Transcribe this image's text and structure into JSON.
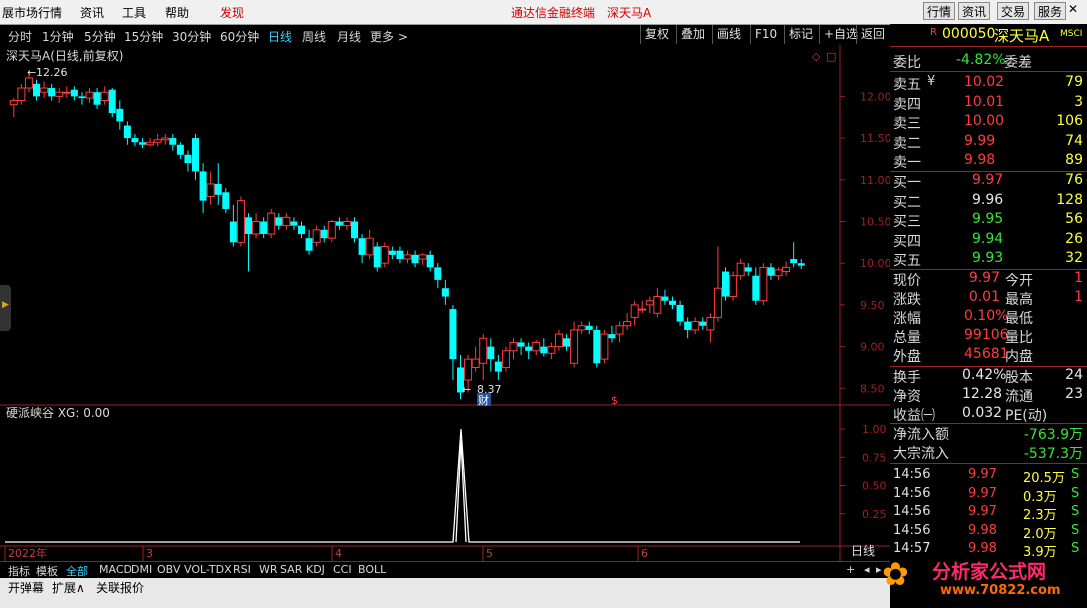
{
  "menu": {
    "items": [
      "展市场行情",
      "资讯",
      "工具",
      "帮助",
      "发现"
    ],
    "center_title": "通达信金融终端",
    "stock_title": "深天马A",
    "right_buttons": [
      "行情",
      "资讯",
      "交易",
      "服务"
    ]
  },
  "periods": [
    "分时",
    "1分钟",
    "5分钟",
    "15分钟",
    "30分钟",
    "60分钟",
    "日线",
    "周线",
    "月线",
    "更多 >"
  ],
  "selected_period": "日线",
  "tools": [
    "复权",
    "叠加",
    "画线",
    "F10",
    "标记",
    "+自选",
    "返回"
  ],
  "chart": {
    "title": "深天马A(日线,前复权)",
    "high_label": "12.26",
    "low_label": "8.37",
    "y_ticks": [
      "12.00",
      "11.50",
      "11.00",
      "10.50",
      "10.00",
      "9.50",
      "9.00",
      "8.50"
    ],
    "indicator_title": "硬派峡谷 XG: 0.00",
    "ind_ticks": [
      "1.00",
      "0.75",
      "0.50",
      "0.25"
    ],
    "x_labels": [
      "2022年",
      "3",
      "4",
      "5",
      "6"
    ],
    "period_label": "日线",
    "marker_cai": "财",
    "marker_s": "$"
  },
  "chart_data": {
    "type": "candlestick",
    "series": [
      {
        "name": "XG",
        "values": [
          0,
          1,
          0
        ]
      }
    ],
    "ylim": [
      8.3,
      12.4
    ],
    "indicator_ylim": [
      0,
      1.0
    ],
    "high": 12.26,
    "low": 8.37
  },
  "tabs": [
    "指标",
    "模板",
    "全部",
    "MACD",
    "DMI",
    "OBV",
    "VOL-TDX",
    "RSI",
    "WR",
    "SAR",
    "KDJ",
    "CCI",
    "BOLL"
  ],
  "selected_tab": "全部",
  "bottom": [
    "开弹幕",
    "扩展∧",
    "关联报价"
  ],
  "panel": {
    "code": "000050",
    "name": "深天马A",
    "tag": "MSCI",
    "r_mark": "R",
    "weibi_label": "委比",
    "weibi_val": "-4.82%",
    "weicha_label": "委差",
    "asks": [
      {
        "label": "卖五",
        "price": "10.02",
        "vol": "79"
      },
      {
        "label": "卖四",
        "price": "10.01",
        "vol": "3"
      },
      {
        "label": "卖三",
        "price": "10.00",
        "vol": "106"
      },
      {
        "label": "卖二",
        "price": "9.99",
        "vol": "74"
      },
      {
        "label": "卖一",
        "price": "9.98",
        "vol": "89"
      }
    ],
    "yen": "¥",
    "bids": [
      {
        "label": "买一",
        "price": "9.97",
        "vol": "76"
      },
      {
        "label": "买二",
        "price": "9.96",
        "vol": "128"
      },
      {
        "label": "买三",
        "price": "9.95",
        "vol": "56"
      },
      {
        "label": "买四",
        "price": "9.94",
        "vol": "26"
      },
      {
        "label": "买五",
        "price": "9.93",
        "vol": "32"
      }
    ],
    "stats": [
      {
        "l1": "现价",
        "v1": "9.97",
        "l2": "今开",
        "v2": "1"
      },
      {
        "l1": "涨跌",
        "v1": "0.01",
        "l2": "最高",
        "v2": "1"
      },
      {
        "l1": "涨幅",
        "v1": "0.10%",
        "l2": "最低",
        "v2": ""
      },
      {
        "l1": "总量",
        "v1": "99106",
        "l2": "量比",
        "v2": ""
      },
      {
        "l1": "外盘",
        "v1": "45681",
        "l2": "内盘",
        "v2": ""
      }
    ],
    "stats2": [
      {
        "l1": "换手",
        "v1": "0.42%",
        "l2": "股本",
        "v2": "24"
      },
      {
        "l1": "净资",
        "v1": "12.28",
        "l2": "流通",
        "v2": "23"
      },
      {
        "l1": "收益㈠",
        "v1": "0.032",
        "l2": "PE(动)",
        "v2": ""
      }
    ],
    "flows": [
      {
        "label": "净流入额",
        "val": "-763.9万"
      },
      {
        "label": "大宗流入",
        "val": "-537.3万"
      }
    ],
    "ticks": [
      {
        "t": "14:56",
        "p": "9.97",
        "v": "20.5万",
        "s": "S"
      },
      {
        "t": "14:56",
        "p": "9.97",
        "v": "0.3万",
        "s": "S"
      },
      {
        "t": "14:56",
        "p": "9.97",
        "v": "2.3万",
        "s": "S"
      },
      {
        "t": "14:56",
        "p": "9.98",
        "v": "2.0万",
        "s": "S"
      },
      {
        "t": "14:57",
        "p": "9.98",
        "v": "3.9万",
        "s": "S"
      }
    ]
  },
  "watermark": {
    "text": "分析家公式网",
    "url": "www.70822.com"
  }
}
